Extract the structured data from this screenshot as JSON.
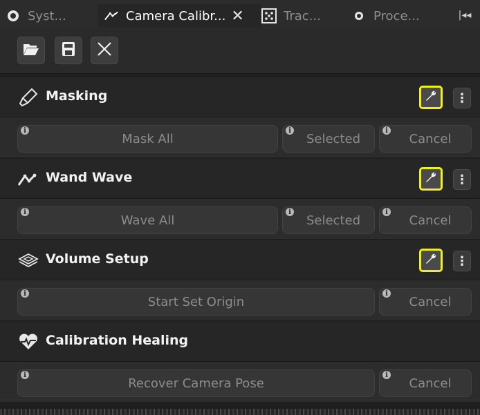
{
  "tabs": [
    {
      "label": "Syst...",
      "icon": "gear-icon"
    },
    {
      "label": "Camera Calibr...",
      "icon": "wand-icon",
      "close": "✕"
    },
    {
      "label": "Trac...",
      "icon": "dots-grid-icon"
    },
    {
      "label": "Proce...",
      "icon": "process-icon"
    }
  ],
  "tabbar": {
    "collapse": "|◂◂"
  },
  "toolbar": {
    "open_icon": "folder-open-icon",
    "save_icon": "save-icon",
    "close_icon": "close-icon"
  },
  "sections": [
    {
      "title": "Masking",
      "icon": "brush-icon",
      "buttons": [
        {
          "label": "Mask All",
          "info": "i"
        },
        {
          "label": "Selected",
          "info": "i"
        },
        {
          "label": "Cancel",
          "info": "i"
        }
      ]
    },
    {
      "title": "Wand Wave",
      "icon": "wand-wave-icon",
      "buttons": [
        {
          "label": "Wave All",
          "info": "i"
        },
        {
          "label": "Selected",
          "info": "i"
        },
        {
          "label": "Cancel",
          "info": "i"
        }
      ]
    },
    {
      "title": "Volume Setup",
      "icon": "volume-layers-icon",
      "buttons": [
        {
          "label": "Start Set Origin",
          "info": "i"
        },
        {
          "label": "Cancel",
          "info": "i"
        }
      ]
    },
    {
      "title": "Calibration Healing",
      "icon": "heart-pulse-icon",
      "buttons": [
        {
          "label": "Recover Camera Pose",
          "info": "i"
        },
        {
          "label": "Cancel",
          "info": "i"
        }
      ]
    }
  ],
  "more_glyph": "⋮",
  "colors": {
    "highlight": "#f1f114",
    "background": "#1f1f1f",
    "panel": "#2c2c2c"
  }
}
